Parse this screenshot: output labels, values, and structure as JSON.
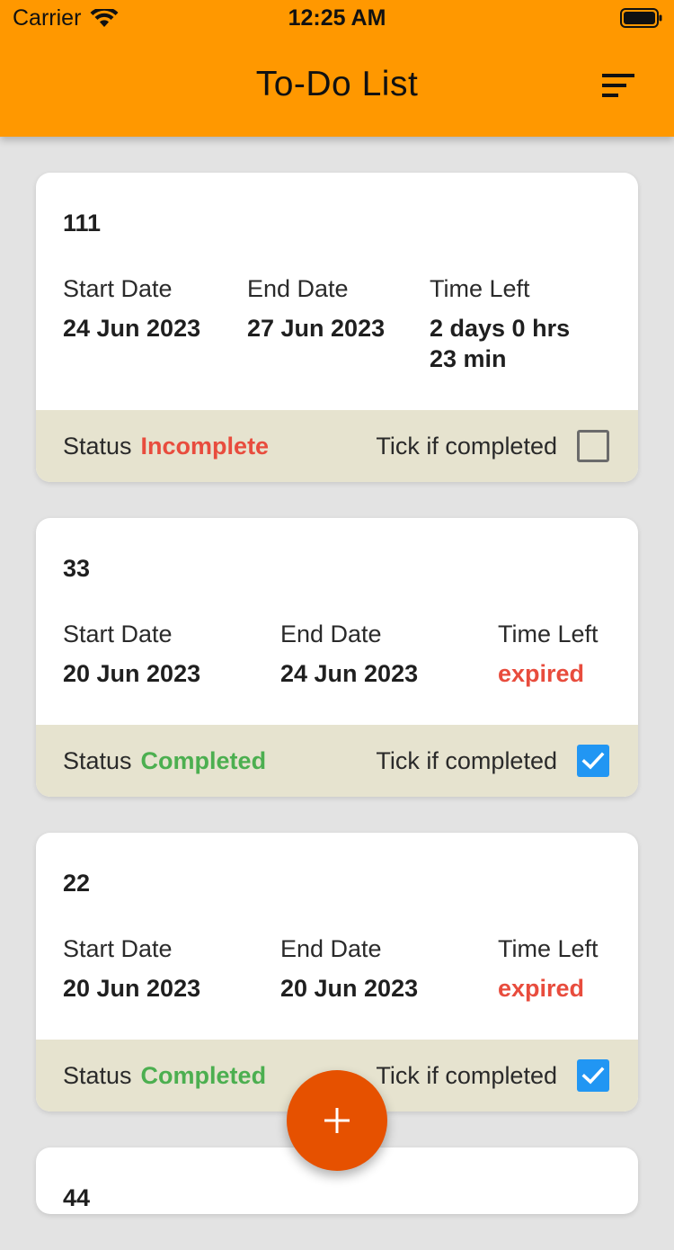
{
  "status_bar": {
    "carrier": "Carrier",
    "time": "12:25 AM"
  },
  "app_bar": {
    "title": "To-Do List",
    "sort_icon": "sort-lines-icon"
  },
  "labels": {
    "start_date": "Start Date",
    "end_date": "End Date",
    "time_left": "Time Left",
    "status": "Status",
    "tick": "Tick if completed"
  },
  "tasks": [
    {
      "title": "111",
      "start_date": "24 Jun 2023",
      "end_date": "27 Jun 2023",
      "time_left_line1": "2 days 0 hrs",
      "time_left_line2": "23 min",
      "status": "Incomplete",
      "completed": false
    },
    {
      "title": "33",
      "start_date": "20 Jun 2023",
      "end_date": "24 Jun 2023",
      "time_left_line1": "expired",
      "status": "Completed",
      "completed": true
    },
    {
      "title": "22",
      "start_date": "20 Jun 2023",
      "end_date": "20 Jun 2023",
      "time_left_line1": "expired",
      "status": "Completed",
      "completed": true
    },
    {
      "title": "44"
    }
  ],
  "fab": {
    "icon": "plus-icon"
  },
  "colors": {
    "app_bar": "#ff9800",
    "background": "#e3e3e3",
    "footer": "#e6e3cf",
    "incomplete": "#e84c3d",
    "completed": "#4caf50",
    "checkbox_checked": "#2196f3",
    "fab": "#e65100"
  }
}
